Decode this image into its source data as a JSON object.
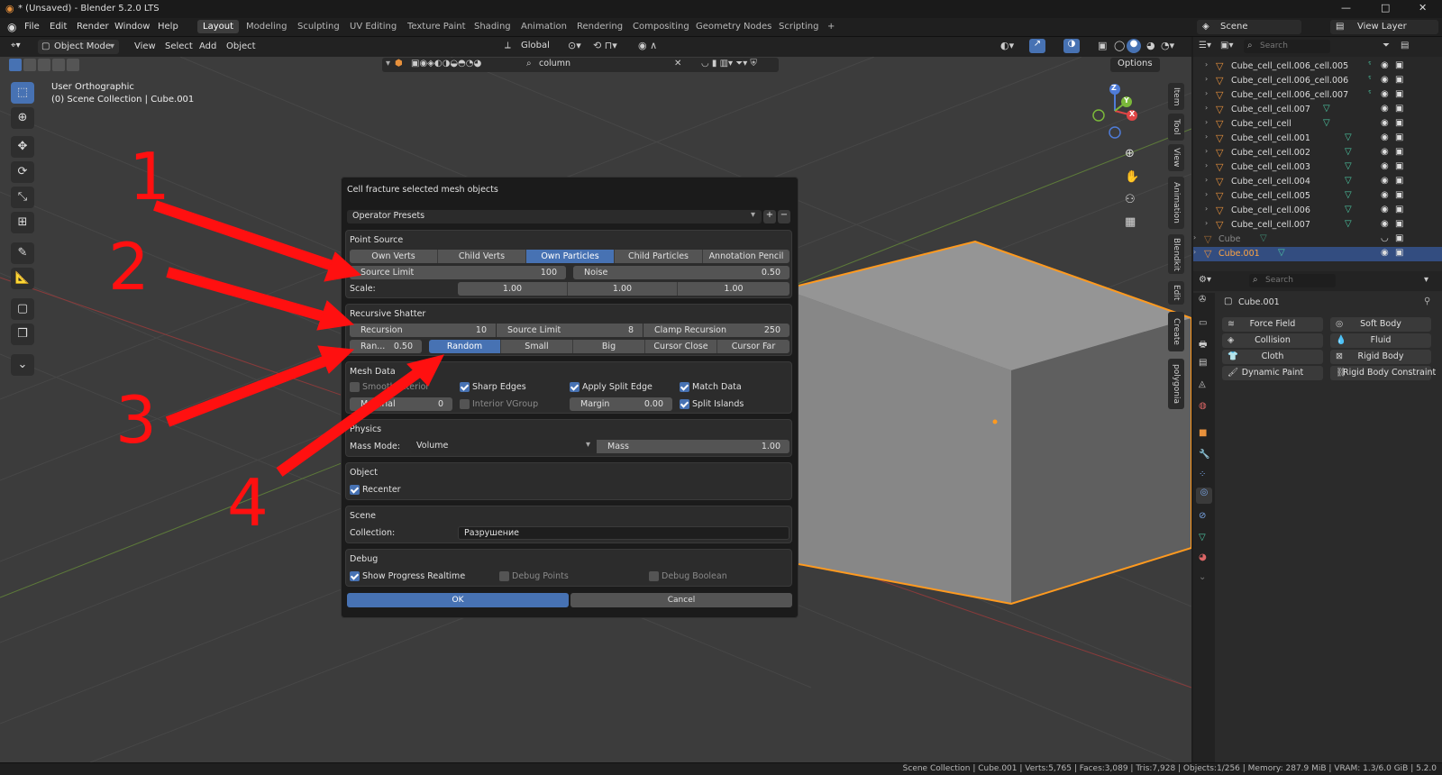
{
  "title_bar": {
    "text": "* (Unsaved) - Blender 5.2.0 LTS",
    "min": "—",
    "max": "□",
    "close": "✕"
  },
  "menu": [
    "File",
    "Edit",
    "Render",
    "Window",
    "Help"
  ],
  "workspaces": [
    "Layout",
    "Modeling",
    "Sculpting",
    "UV Editing",
    "Texture Paint",
    "Shading",
    "Animation",
    "Rendering",
    "Compositing",
    "Geometry Nodes",
    "Scripting"
  ],
  "workspace_add": "+",
  "scene": {
    "label": "Scene",
    "view_layer": "View Layer"
  },
  "viewport_header": {
    "mode": "Object Mode",
    "menus": [
      "View",
      "Select",
      "Add",
      "Object"
    ],
    "transform": "Global",
    "options": "Options",
    "search_value": "column",
    "search_clear": "✕"
  },
  "viewport_info": {
    "line1": "User Orthographic",
    "line2": "(0) Scene Collection | Cube.001"
  },
  "gizmo": {
    "z": "Z",
    "y": "Y",
    "x": "X"
  },
  "side_tabs": [
    "Item",
    "Tool",
    "View",
    "Animation",
    "Blendkit",
    "Edit",
    "Create",
    "polygonia"
  ],
  "annotations": [
    "1",
    "2",
    "3",
    "4"
  ],
  "dialog": {
    "title": "Cell fracture selected mesh objects",
    "presets": "Operator Presets",
    "preset_add": "+",
    "preset_remove": "−",
    "point_source": {
      "title": "Point Source",
      "options": [
        "Own Verts",
        "Child Verts",
        "Own Particles",
        "Child Particles",
        "Annotation Pencil"
      ],
      "selected": "Own Particles",
      "source_limit_label": "Source Limit",
      "source_limit": "100",
      "noise_label": "Noise",
      "noise": "0.50",
      "scale_label": "Scale:",
      "scale": [
        "1.00",
        "1.00",
        "1.00"
      ]
    },
    "recursive": {
      "title": "Recursive Shatter",
      "recursion_label": "Recursion",
      "recursion": "10",
      "source_limit_label": "Source Limit",
      "source_limit": "8",
      "clamp_label": "Clamp Recursion",
      "clamp": "250",
      "random_label": "Ran...",
      "random": "0.50",
      "modes": [
        "Random",
        "Small",
        "Big",
        "Cursor Close",
        "Cursor Far"
      ],
      "selected": "Random"
    },
    "mesh_data": {
      "title": "Mesh Data",
      "smooth_interior": "Smooth Interior",
      "sharp_edges": "Sharp Edges",
      "apply_split_edge": "Apply Split Edge",
      "match_data": "Match Data",
      "material_label": "Material",
      "material": "0",
      "interior_vgroup": "Interior VGroup",
      "margin_label": "Margin",
      "margin": "0.00",
      "split_islands": "Split Islands"
    },
    "physics": {
      "title": "Physics",
      "mass_mode_label": "Mass Mode:",
      "mass_mode": "Volume",
      "mass_label": "Mass",
      "mass": "1.00"
    },
    "object": {
      "title": "Object",
      "recenter": "Recenter"
    },
    "scene": {
      "title": "Scene",
      "collection_label": "Collection:",
      "collection": "Разрушение"
    },
    "debug": {
      "title": "Debug",
      "show_progress": "Show Progress Realtime",
      "debug_points": "Debug Points",
      "debug_boolean": "Debug Boolean"
    },
    "ok": "OK",
    "cancel": "Cancel"
  },
  "outliner": {
    "search_placeholder": "Search",
    "rows": [
      "Cube_cell_cell.006_cell.005",
      "Cube_cell_cell.006_cell.006",
      "Cube_cell_cell.006_cell.007",
      "Cube_cell_cell.007",
      "Cube_cell_cell",
      "Cube_cell_cell.001",
      "Cube_cell_cell.002",
      "Cube_cell_cell.003",
      "Cube_cell_cell.004",
      "Cube_cell_cell.005",
      "Cube_cell_cell.006",
      "Cube_cell_cell.007",
      "Cube",
      "Cube.001"
    ]
  },
  "properties": {
    "search_placeholder": "Search",
    "object_name": "Cube.001",
    "physics_buttons": [
      "Force Field",
      "Soft Body",
      "Collision",
      "Fluid",
      "Cloth",
      "Rigid Body",
      "Dynamic Paint",
      "Rigid Body Constraint"
    ]
  },
  "status": "Scene Collection | Cube.001 | Verts:5,765 | Faces:3,089 | Tris:7,928 | Objects:1/256 | Memory: 287.9 MiB | VRAM: 1.3/6.0 GiB | 5.2.0",
  "colors": {
    "accent": "#4772b3",
    "selection": "#ff9a1f",
    "arrow": "#ff1010"
  }
}
